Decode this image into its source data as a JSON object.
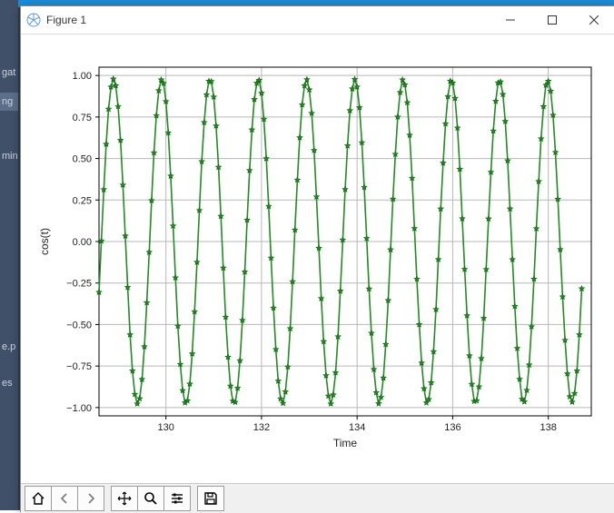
{
  "window": {
    "title": "Figure 1",
    "controls": {
      "minimize": "—",
      "maximize": "▢",
      "close": "✕"
    }
  },
  "background_labels": [
    "gat",
    "ng",
    "min",
    "e.p",
    "es",
    ")"
  ],
  "toolbar": {
    "home": "home-icon",
    "back": "back-icon",
    "forward": "forward-icon",
    "pan": "pan-icon",
    "zoom": "zoom-icon",
    "configure": "configure-icon",
    "save": "save-icon"
  },
  "chart_data": {
    "type": "line",
    "title": "",
    "xlabel": "Time",
    "ylabel": "cos(t)",
    "xlim": [
      128.6,
      138.9
    ],
    "ylim": [
      -1.05,
      1.05
    ],
    "xticks": [
      130,
      132,
      134,
      136,
      138
    ],
    "yticks": [
      -1.0,
      -0.75,
      -0.5,
      -0.25,
      0.0,
      0.25,
      0.5,
      0.75,
      1.0
    ],
    "ytick_labels": [
      "−1.00",
      "−0.75",
      "−0.50",
      "−0.25",
      "0.00",
      "0.25",
      "0.50",
      "0.75",
      "1.00"
    ],
    "marker": "star",
    "color": "#228b22",
    "series": [
      {
        "name": "cos(t)",
        "x": [
          128.6,
          128.65,
          128.7,
          128.75,
          128.8,
          128.85,
          128.9,
          128.95,
          129.0,
          129.05,
          129.1,
          129.15,
          129.2,
          129.25,
          129.3,
          129.35,
          129.4,
          129.45,
          129.5,
          129.55,
          129.6,
          129.65,
          129.7,
          129.75,
          129.8,
          129.85,
          129.9,
          129.95,
          130.0,
          130.05,
          130.1,
          130.15,
          130.2,
          130.25,
          130.3,
          130.35,
          130.4,
          130.45,
          130.5,
          130.55,
          130.6,
          130.65,
          130.7,
          130.75,
          130.8,
          130.85,
          130.9,
          130.95,
          131.0,
          131.05,
          131.1,
          131.15,
          131.2,
          131.25,
          131.3,
          131.35,
          131.4,
          131.45,
          131.5,
          131.55,
          131.6,
          131.65,
          131.7,
          131.75,
          131.8,
          131.85,
          131.9,
          131.95,
          132.0,
          132.05,
          132.1,
          132.15,
          132.2,
          132.25,
          132.3,
          132.35,
          132.4,
          132.45,
          132.5,
          132.55,
          132.6,
          132.65,
          132.7,
          132.75,
          132.8,
          132.85,
          132.9,
          132.95,
          133.0,
          133.05,
          133.1,
          133.15,
          133.2,
          133.25,
          133.3,
          133.35,
          133.4,
          133.45,
          133.5,
          133.55,
          133.6,
          133.65,
          133.7,
          133.75,
          133.8,
          133.85,
          133.9,
          133.95,
          134.0,
          134.05,
          134.1,
          134.15,
          134.2,
          134.25,
          134.3,
          134.35,
          134.4,
          134.45,
          134.5,
          134.55,
          134.6,
          134.65,
          134.7,
          134.75,
          134.8,
          134.85,
          134.9,
          134.95,
          135.0,
          135.05,
          135.1,
          135.15,
          135.2,
          135.25,
          135.3,
          135.35,
          135.4,
          135.45,
          135.5,
          135.55,
          135.6,
          135.65,
          135.7,
          135.75,
          135.8,
          135.85,
          135.9,
          135.95,
          136.0,
          136.05,
          136.1,
          136.15,
          136.2,
          136.25,
          136.3,
          136.35,
          136.4,
          136.45,
          136.5,
          136.55,
          136.6,
          136.65,
          136.7,
          136.75,
          136.8,
          136.85,
          136.9,
          136.95,
          137.0,
          137.05,
          137.1,
          137.15,
          137.2,
          137.25,
          137.3,
          137.35,
          137.4,
          137.45,
          137.5,
          137.55,
          137.6,
          137.65,
          137.7,
          137.75,
          137.8,
          137.85,
          137.9,
          137.95,
          138.0,
          138.05,
          138.1,
          138.15,
          138.2,
          138.25,
          138.3,
          138.35,
          138.4,
          138.45,
          138.5,
          138.55,
          138.6,
          138.65,
          138.7,
          138.75,
          138.8,
          138.85,
          138.9
        ],
        "y": [
          -0.305,
          0.004,
          0.313,
          0.587,
          0.798,
          0.931,
          0.979,
          0.939,
          0.814,
          0.61,
          0.341,
          0.034,
          -0.276,
          -0.561,
          -0.779,
          -0.92,
          -0.977,
          -0.946,
          -0.83,
          -0.633,
          -0.368,
          -0.064,
          0.247,
          0.535,
          0.759,
          0.909,
          0.974,
          0.953,
          0.844,
          0.655,
          0.395,
          0.094,
          -0.218,
          -0.509,
          -0.739,
          -0.897,
          -0.971,
          -0.959,
          -0.858,
          -0.676,
          -0.422,
          -0.124,
          0.188,
          0.482,
          0.717,
          0.884,
          0.966,
          0.964,
          0.871,
          0.697,
          0.448,
          0.153,
          -0.159,
          -0.455,
          -0.696,
          -0.87,
          -0.961,
          -0.968,
          -0.883,
          -0.717,
          -0.474,
          -0.183,
          0.129,
          0.428,
          0.673,
          0.856,
          0.954,
          0.972,
          0.894,
          0.737,
          0.5,
          0.212,
          -0.099,
          -0.4,
          -0.65,
          -0.84,
          -0.947,
          -0.974,
          -0.905,
          -0.755,
          -0.524,
          -0.241,
          0.07,
          0.371,
          0.626,
          0.824,
          0.939,
          0.976,
          0.914,
          0.773,
          0.549,
          0.27,
          -0.04,
          -0.343,
          -0.602,
          -0.807,
          -0.93,
          -0.977,
          -0.923,
          -0.79,
          -0.573,
          -0.298,
          0.01,
          0.314,
          0.577,
          0.789,
          0.92,
          0.977,
          0.931,
          0.807,
          0.596,
          0.327,
          0.019,
          -0.285,
          -0.552,
          -0.77,
          -0.91,
          -0.976,
          -0.938,
          -0.822,
          -0.619,
          -0.355,
          -0.049,
          0.256,
          0.526,
          0.751,
          0.898,
          0.974,
          0.944,
          0.837,
          0.641,
          0.382,
          0.079,
          -0.226,
          -0.5,
          -0.731,
          -0.886,
          -0.971,
          -0.95,
          -0.85,
          -0.663,
          -0.409,
          -0.108,
          0.197,
          0.473,
          0.71,
          0.873,
          0.967,
          0.955,
          0.863,
          0.684,
          0.436,
          0.138,
          -0.167,
          -0.446,
          -0.688,
          -0.859,
          -0.962,
          -0.959,
          -0.875,
          -0.704,
          -0.462,
          -0.168,
          0.137,
          0.418,
          0.666,
          0.845,
          0.956,
          0.962,
          0.886,
          0.724,
          0.487,
          0.197,
          -0.108,
          -0.39,
          -0.643,
          -0.829,
          -0.949,
          -0.965,
          -0.896,
          -0.743,
          -0.512,
          -0.226,
          0.078,
          0.362,
          0.619,
          0.813,
          0.942,
          0.966,
          0.906,
          0.761,
          0.537,
          0.255,
          -0.048,
          -0.333,
          -0.594,
          -0.796,
          -0.934,
          -0.967,
          -0.914,
          -0.779,
          -0.561,
          -0.284
        ]
      }
    ]
  }
}
